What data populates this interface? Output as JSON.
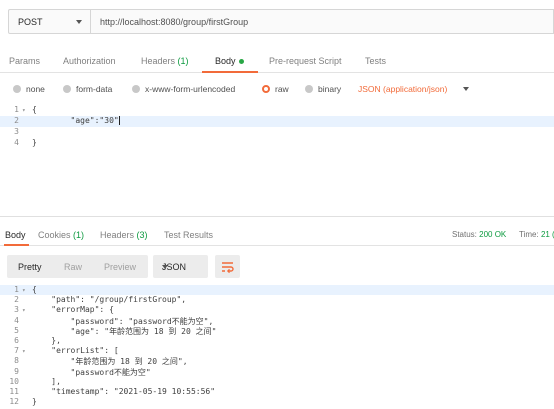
{
  "request": {
    "method": "POST",
    "url": "http://localhost:8080/group/firstGroup"
  },
  "request_tabs": [
    {
      "label": "Params"
    },
    {
      "label": "Authorization"
    },
    {
      "label": "Headers",
      "count": "(1)"
    },
    {
      "label": "Body",
      "active": true
    },
    {
      "label": "Pre-request Script"
    },
    {
      "label": "Tests"
    }
  ],
  "body_types": [
    {
      "label": "none"
    },
    {
      "label": "form-data"
    },
    {
      "label": "x-www-form-urlencoded"
    },
    {
      "label": "raw",
      "selected": true
    },
    {
      "label": "binary"
    }
  ],
  "body_format": "JSON (application/json)",
  "request_body": [
    {
      "n": "1",
      "text": "{",
      "fold": true
    },
    {
      "n": "2",
      "text": "        \"age\":\"30\"",
      "highlight": true
    },
    {
      "n": "3",
      "text": ""
    },
    {
      "n": "4",
      "text": "}"
    }
  ],
  "response_tabs": [
    {
      "label": "Body",
      "active": true
    },
    {
      "label": "Cookies",
      "count": "(1)"
    },
    {
      "label": "Headers",
      "count": "(3)"
    },
    {
      "label": "Test Results"
    }
  ],
  "response_status": {
    "label": "Status:",
    "value": "200 OK",
    "time_label": "Time:",
    "time_value": "21 ("
  },
  "view_modes": [
    {
      "label": "Pretty",
      "active": true
    },
    {
      "label": "Raw"
    },
    {
      "label": "Preview"
    }
  ],
  "view_format": "JSON",
  "response_body": [
    {
      "n": "1",
      "text": "{",
      "fold": true,
      "highlight": true
    },
    {
      "n": "2",
      "text": "    \"path\": \"/group/firstGroup\","
    },
    {
      "n": "3",
      "text": "    \"errorMap\": {",
      "fold": true
    },
    {
      "n": "4",
      "text": "        \"password\": \"password不能为空\","
    },
    {
      "n": "5",
      "text": "        \"age\": \"年龄范围为 18 到 20 之间\""
    },
    {
      "n": "6",
      "text": "    },"
    },
    {
      "n": "7",
      "text": "    \"errorList\": [",
      "fold": true
    },
    {
      "n": "8",
      "text": "        \"年龄范围为 18 到 20 之间\","
    },
    {
      "n": "9",
      "text": "        \"password不能为空\""
    },
    {
      "n": "10",
      "text": "    ],"
    },
    {
      "n": "11",
      "text": "    \"timestamp\": \"2021-05-19 10:55:56\""
    },
    {
      "n": "12",
      "text": "}"
    }
  ],
  "colors": {
    "accent": "#f26b3a",
    "success": "#0c9a3f"
  }
}
